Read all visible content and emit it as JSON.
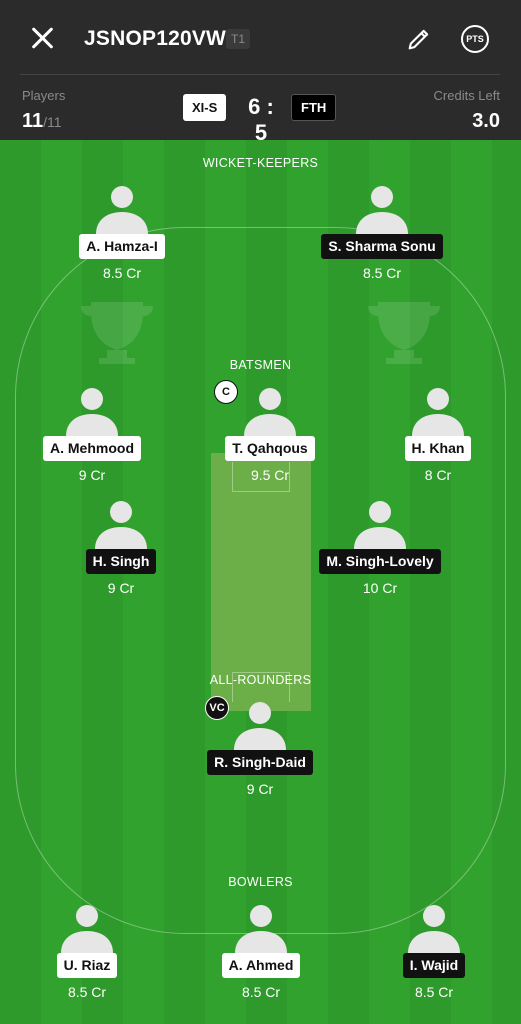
{
  "header": {
    "team_name": "JSNOP120VW",
    "team_tag": "T1",
    "players_label": "Players",
    "players_selected": "11",
    "players_total": "/11",
    "credits_label": "Credits Left",
    "credits_left": "3.0",
    "team1": "XI-S",
    "team2": "FTH",
    "score": "6 : 5",
    "pts_label": "PTS"
  },
  "sections": {
    "wk": "WICKET-KEEPERS",
    "bat": "BATSMEN",
    "ar": "ALL-ROUNDERS",
    "bowl": "BOWLERS"
  },
  "players": [
    {
      "name": "A. Hamza-I",
      "credit": "8.5 Cr",
      "team": "XI-S"
    },
    {
      "name": "S. Sharma Sonu",
      "credit": "8.5 Cr",
      "team": "FTH"
    },
    {
      "name": "A. Mehmood",
      "credit": "9 Cr",
      "team": "XI-S"
    },
    {
      "name": "T. Qahqous",
      "credit": "9.5 Cr",
      "team": "XI-S"
    },
    {
      "name": "H. Khan",
      "credit": "8 Cr",
      "team": "XI-S"
    },
    {
      "name": "H. Singh",
      "credit": "9 Cr",
      "team": "FTH"
    },
    {
      "name": "M. Singh-Lovely",
      "credit": "10 Cr",
      "team": "FTH"
    },
    {
      "name": "R. Singh-Daid",
      "credit": "9 Cr",
      "team": "FTH"
    },
    {
      "name": "U. Riaz",
      "credit": "8.5 Cr",
      "team": "XI-S"
    },
    {
      "name": "A. Ahmed",
      "credit": "8.5 Cr",
      "team": "XI-S"
    },
    {
      "name": "I. Wajid",
      "credit": "8.5 Cr",
      "team": "FTH"
    }
  ],
  "badges": {
    "captain": "C",
    "vice_captain": "VC"
  },
  "colors": {
    "field_green": "#2e9a2b",
    "pitch": "#6cae48",
    "header_bg": "#2b2b2b"
  }
}
